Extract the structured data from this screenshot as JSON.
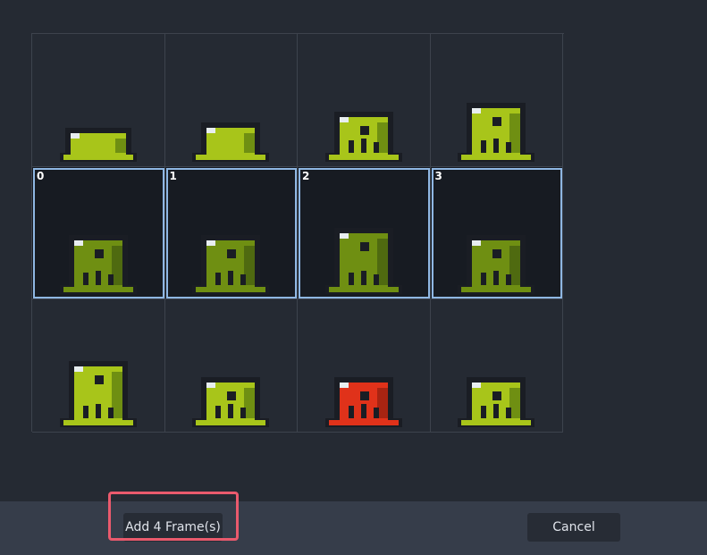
{
  "colors": {
    "slime_green": "#a8c51a",
    "slime_dark_green": "#6f8f12",
    "slime_shadow": "#1a1d24",
    "slime_red": "#e0321a",
    "selection_border": "#8fb7e3",
    "highlight_border": "#ea5a6d"
  },
  "frames": [
    {
      "label": "",
      "selected": false,
      "pose": "flat",
      "color": "green"
    },
    {
      "label": "",
      "selected": false,
      "pose": "blob",
      "color": "green"
    },
    {
      "label": "",
      "selected": false,
      "pose": "rise",
      "color": "green"
    },
    {
      "label": "",
      "selected": false,
      "pose": "tall",
      "color": "green"
    },
    {
      "label": "0",
      "selected": true,
      "pose": "tall",
      "color": "dim"
    },
    {
      "label": "1",
      "selected": true,
      "pose": "tall",
      "color": "dim"
    },
    {
      "label": "2",
      "selected": true,
      "pose": "taller",
      "color": "dim"
    },
    {
      "label": "3",
      "selected": true,
      "pose": "tall",
      "color": "dim"
    },
    {
      "label": "",
      "selected": false,
      "pose": "taller",
      "color": "green"
    },
    {
      "label": "",
      "selected": false,
      "pose": "rise",
      "color": "green"
    },
    {
      "label": "",
      "selected": false,
      "pose": "rise",
      "color": "red"
    },
    {
      "label": "",
      "selected": false,
      "pose": "rise",
      "color": "green"
    }
  ],
  "footer": {
    "add_label": "Add 4 Frame(s)",
    "cancel_label": "Cancel"
  }
}
